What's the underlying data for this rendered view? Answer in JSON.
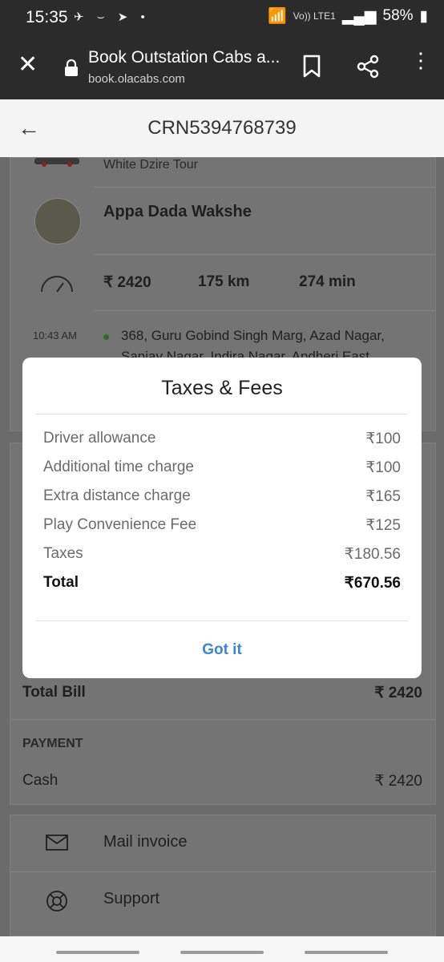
{
  "status": {
    "time": "15:35",
    "battery": "58%",
    "network_label": "Vo)) LTE1"
  },
  "browser": {
    "title": "Book Outstation Cabs a...",
    "url": "book.olacabs.com"
  },
  "header": {
    "crn": "CRN5394768739"
  },
  "trip": {
    "car": "White Dzire Tour",
    "driver_name": "Appa Dada Wakshe",
    "fare": "₹ 2420",
    "distance": "175 km",
    "duration": "274 min",
    "pickup_time": "10:43 AM",
    "pickup_address_line1": "368, Guru Gobind Singh Marg, Azad Nagar,",
    "pickup_address_line2": "Sanjay Nagar, Indira Nagar, Andheri East,"
  },
  "bill": {
    "total_label": "Total Bill",
    "total_value": "₹ 2420",
    "payment_heading": "PAYMENT",
    "payment_method": "Cash",
    "payment_value": "₹ 2420"
  },
  "actions": {
    "mail_invoice": "Mail invoice",
    "support": "Support"
  },
  "modal": {
    "title": "Taxes & Fees",
    "rows": [
      {
        "label": "Driver allowance",
        "value": "₹100"
      },
      {
        "label": "Additional time charge",
        "value": "₹100"
      },
      {
        "label": "Extra distance charge",
        "value": "₹165"
      },
      {
        "label": "Play Convenience Fee",
        "value": "₹125"
      },
      {
        "label": "Taxes",
        "value": "₹180.56"
      }
    ],
    "total_label": "Total",
    "total_value": "₹670.56",
    "button": "Got it"
  }
}
